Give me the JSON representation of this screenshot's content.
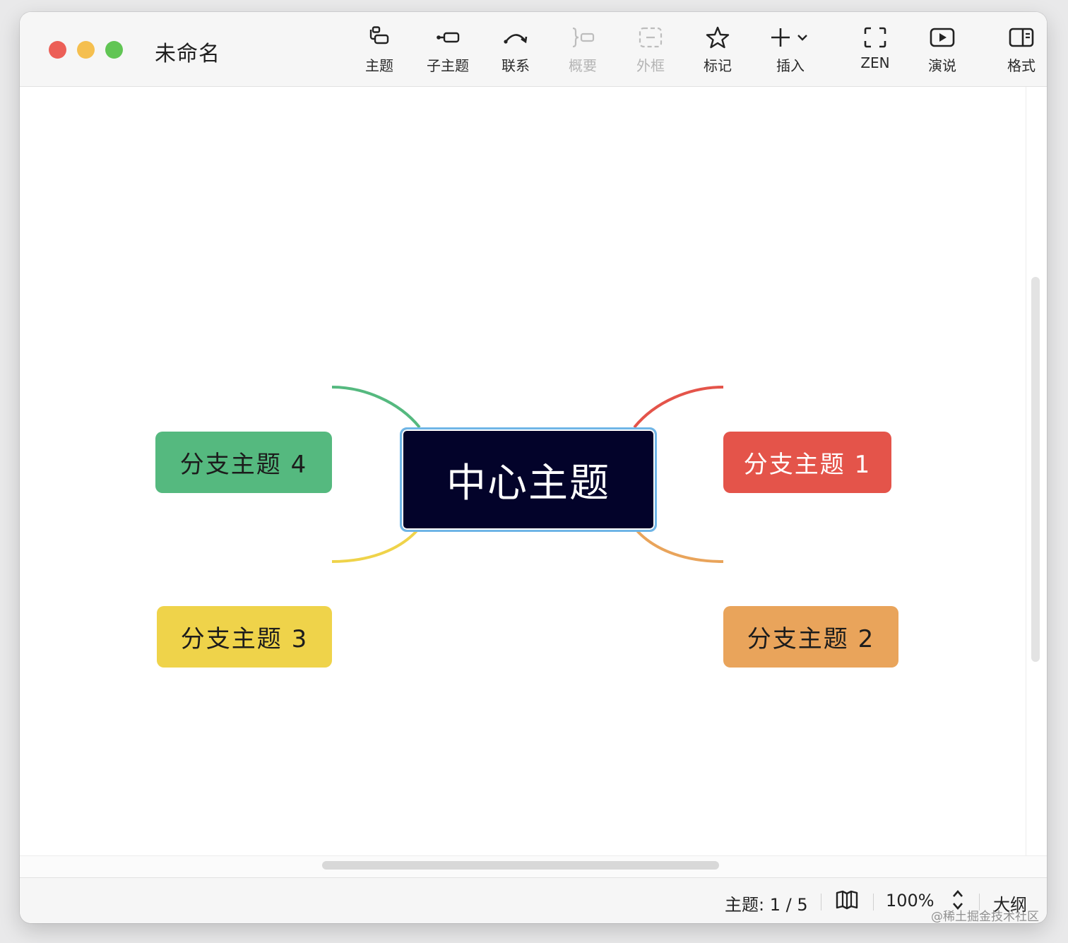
{
  "window": {
    "title": "未命名"
  },
  "toolbar": {
    "items": [
      {
        "label": "主题",
        "icon": "topic-icon",
        "enabled": true
      },
      {
        "label": "子主题",
        "icon": "subtopic-icon",
        "enabled": true
      },
      {
        "label": "联系",
        "icon": "relationship-icon",
        "enabled": true
      },
      {
        "label": "概要",
        "icon": "summary-icon",
        "enabled": false
      },
      {
        "label": "外框",
        "icon": "boundary-icon",
        "enabled": false
      },
      {
        "label": "标记",
        "icon": "star-icon",
        "enabled": true
      },
      {
        "label": "插入",
        "icon": "plus-icon",
        "enabled": true
      },
      {
        "label": "ZEN",
        "icon": "zen-fullscreen-icon",
        "enabled": true
      },
      {
        "label": "演说",
        "icon": "pitch-play-icon",
        "enabled": true
      },
      {
        "label": "格式",
        "icon": "format-panel-icon",
        "enabled": true
      }
    ]
  },
  "mindmap": {
    "central": {
      "label": "中心主题",
      "color": "#03032a",
      "selected": true
    },
    "branches": [
      {
        "label": "分支主题 1",
        "color": "#e4544a"
      },
      {
        "label": "分支主题 2",
        "color": "#e9a45b"
      },
      {
        "label": "分支主题 3",
        "color": "#efd34a"
      },
      {
        "label": "分支主题 4",
        "color": "#55b97f"
      }
    ]
  },
  "statusbar": {
    "topic_count": "主题: 1 / 5",
    "zoom": "100%",
    "outline_label": "大纲",
    "watermark": "@稀土掘金技术社区"
  },
  "colors": {
    "selection": "#6fb5e6"
  }
}
